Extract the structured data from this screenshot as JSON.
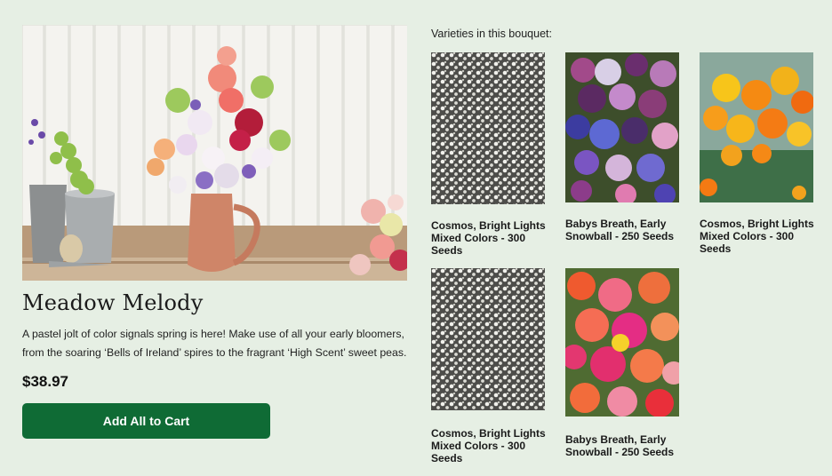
{
  "product": {
    "title": "Meadow Melody",
    "description": "A pastel jolt of color signals spring is here! Make use of all your early bloomers, from the soaring ‘Bells of Ireland’ spires to the fragrant ‘High Scent’ sweet peas.",
    "price": "$38.97",
    "cta_label": "Add All to Cart"
  },
  "varieties": {
    "heading": "Varieties in this bouquet:",
    "items": [
      {
        "name": "Cosmos, Bright Lights Mixed Colors - 300 Seeds",
        "image": "babys-breath-photo"
      },
      {
        "name": "Babys Breath, Early Snowball - 250 Seeds",
        "image": "cornflower-photo"
      },
      {
        "name": "Cosmos, Bright Lights Mixed Colors - 300 Seeds",
        "image": "cosmos-orange-photo"
      },
      {
        "name": "Cosmos, Bright Lights Mixed Colors - 300 Seeds",
        "image": "babys-breath-photo"
      },
      {
        "name": "Babys Breath, Early Snowball - 250 Seeds",
        "image": "zinnia-photo"
      }
    ]
  },
  "colors": {
    "page_background": "#e6efe4",
    "cta_background": "#0f6b35",
    "cta_text": "#ffffff"
  }
}
